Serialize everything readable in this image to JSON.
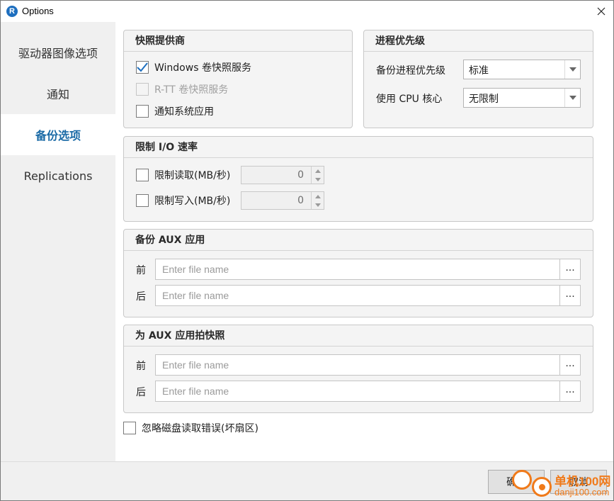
{
  "window": {
    "title": "Options",
    "app_icon": "R"
  },
  "sidebar": {
    "items": [
      {
        "label": "驱动器图像选项"
      },
      {
        "label": "通知"
      },
      {
        "label": "备份选项"
      },
      {
        "label": "Replications"
      }
    ]
  },
  "snapshot_provider": {
    "title": "快照提供商",
    "windows_vss": {
      "label": "Windows 卷快照服务",
      "checked": true
    },
    "rtt_vss": {
      "label": "R-TT 卷快照服务",
      "checked": false,
      "disabled": true
    },
    "notify_apps": {
      "label": "通知系统应用",
      "checked": false
    }
  },
  "priority": {
    "title": "进程优先级",
    "backup_priority": {
      "label": "备份进程优先级",
      "value": "标准"
    },
    "cpu_cores": {
      "label": "使用 CPU 核心",
      "value": "无限制"
    }
  },
  "io_limit": {
    "title": "限制 I/O 速率",
    "read": {
      "label": "限制读取(MB/秒)",
      "value": "0"
    },
    "write": {
      "label": "限制写入(MB/秒)",
      "value": "0"
    }
  },
  "backup_aux": {
    "title": "备份 AUX 应用",
    "before_label": "前",
    "after_label": "后",
    "placeholder": "Enter file name",
    "browse_label": "..."
  },
  "snapshot_aux": {
    "title": "为 AUX 应用拍快照",
    "before_label": "前",
    "after_label": "后",
    "placeholder": "Enter file name",
    "browse_label": "..."
  },
  "ignore_errors": {
    "label": "忽略磁盘读取错误(坏扇区)",
    "checked": false
  },
  "footer": {
    "ok_label": "确认",
    "cancel_label": "取消"
  },
  "watermark": {
    "line1": "单机100网",
    "line2": "danji100.com"
  },
  "colors": {
    "accent": "#1a6aa6",
    "check": "#1e6fbf"
  }
}
